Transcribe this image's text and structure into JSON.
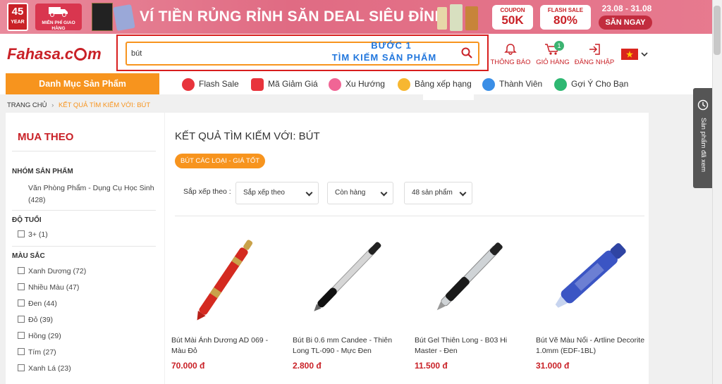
{
  "colors": {
    "brand_red": "#c92127",
    "orange": "#f7941e",
    "annotation_blue": "#2277dd",
    "annotation_border": "#d81e1e"
  },
  "banner": {
    "anniversary": "45",
    "anniversary_sub": "YEAR",
    "freeship": "MIỄN PHÍ GIAO HÀNG",
    "headline": "VÍ TIỀN RỦNG RỈNH SĂN DEAL SIÊU ĐỈNH",
    "coupon_label": "COUPON",
    "coupon_value": "50K",
    "flash_label": "FLASH SALE",
    "flash_value": "80%",
    "dates": "23.08 - 31.08",
    "cta": "SĂN NGAY"
  },
  "header": {
    "logo_prefix": "Fahasa.c",
    "logo_suffix": "m",
    "search_value": "bút",
    "annotation_line1": "BƯỚC 1",
    "annotation_line2": "TÌM KIẾM SẢN PHẨM",
    "notifications_label": "THÔNG BÁO",
    "cart_label": "GIỎ HÀNG",
    "cart_count": "1",
    "login_label": "ĐĂNG NHẬP"
  },
  "nav": {
    "category_button": "Danh Mục Sản Phẩm",
    "items": [
      "Flash Sale",
      "Mã Giảm Giá",
      "Xu Hướng",
      "Bảng xếp hạng",
      "Thành Viên",
      "Gợi Ý Cho Bạn"
    ]
  },
  "breadcrumb": {
    "home": "TRANG CHỦ",
    "current": "KẾT QUẢ TÌM KIẾM VỚI: BÚT"
  },
  "sidebar": {
    "title": "MUA THEO",
    "group_title": "NHÓM SẢN PHẨM",
    "group_item": "Văn Phòng Phẩm - Dụng Cụ Học Sinh",
    "group_count": "(428)",
    "age_title": "ĐỘ TUỔI",
    "ages": [
      {
        "label": "3+",
        "count": "(1)"
      }
    ],
    "color_title": "MÀU SẮC",
    "colors": [
      {
        "label": "Xanh Dương",
        "count": "(72)"
      },
      {
        "label": "Nhiều Màu",
        "count": "(47)"
      },
      {
        "label": "Đen",
        "count": "(44)"
      },
      {
        "label": "Đỏ",
        "count": "(39)"
      },
      {
        "label": "Hồng",
        "count": "(29)"
      },
      {
        "label": "Tím",
        "count": "(27)"
      },
      {
        "label": "Xanh Lá",
        "count": "(23)"
      }
    ]
  },
  "main": {
    "heading": "KẾT QUẢ TÌM KIẾM VỚI: BÚT",
    "tag": "BÚT CÁC LOẠI - GIÁ TỐT",
    "sort_label": "Sắp xếp theo :",
    "sort_select": "Sắp xếp theo",
    "stock_select": "Còn hàng",
    "perpage_select": "48 sản phẩm"
  },
  "products": [
    {
      "line1": "Bút Mài Ánh Dương AD 069 -",
      "line2": "Màu Đỏ",
      "price": "70.000 đ",
      "icon": "red-fountain-pen"
    },
    {
      "line1": "Bút Bi 0.6 mm Candee - Thiên",
      "line2": "Long TL-090 - Mực Đen",
      "price": "2.800 đ",
      "icon": "black-ballpoint-pen"
    },
    {
      "line1": "Bút Gel Thiên Long - B03 Hi",
      "line2": "Master - Đen",
      "price": "11.500 đ",
      "icon": "black-gel-pen"
    },
    {
      "line1": "Bút Vẽ Màu Nổi - Artline Decorite",
      "line2": "1.0mm (EDF-1BL)",
      "price": "31.000 đ",
      "icon": "blue-marker"
    }
  ],
  "side_widget": {
    "label": "Sản phẩm đã xem"
  }
}
